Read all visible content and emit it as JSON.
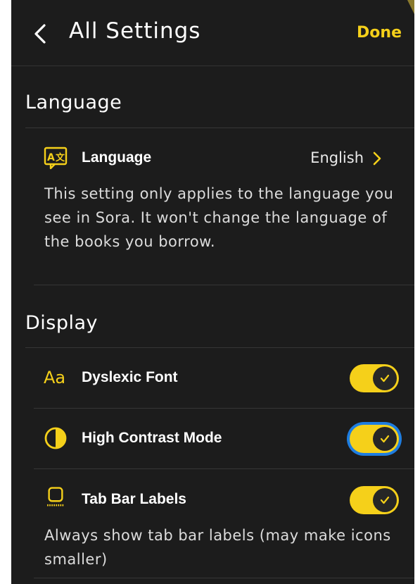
{
  "header": {
    "title": "All Settings",
    "done_label": "Done"
  },
  "language": {
    "section_title": "Language",
    "row_label": "Language",
    "value": "English",
    "description": "This setting only applies to the language you see in Sora. It won't change the language of the books you borrow.",
    "icon": "translate-icon"
  },
  "display": {
    "section_title": "Display",
    "dyslexic": {
      "label": "Dyslexic Font",
      "icon_text": "Aa",
      "enabled": true
    },
    "contrast": {
      "label": "High Contrast Mode",
      "enabled": true
    },
    "tabbar": {
      "label": "Tab Bar Labels",
      "enabled": true,
      "description": "Always show tab bar labels (may make icons smaller)"
    }
  },
  "colors": {
    "accent": "#f5d01a",
    "background": "#1c1c1c",
    "focus": "#1e7de0"
  }
}
